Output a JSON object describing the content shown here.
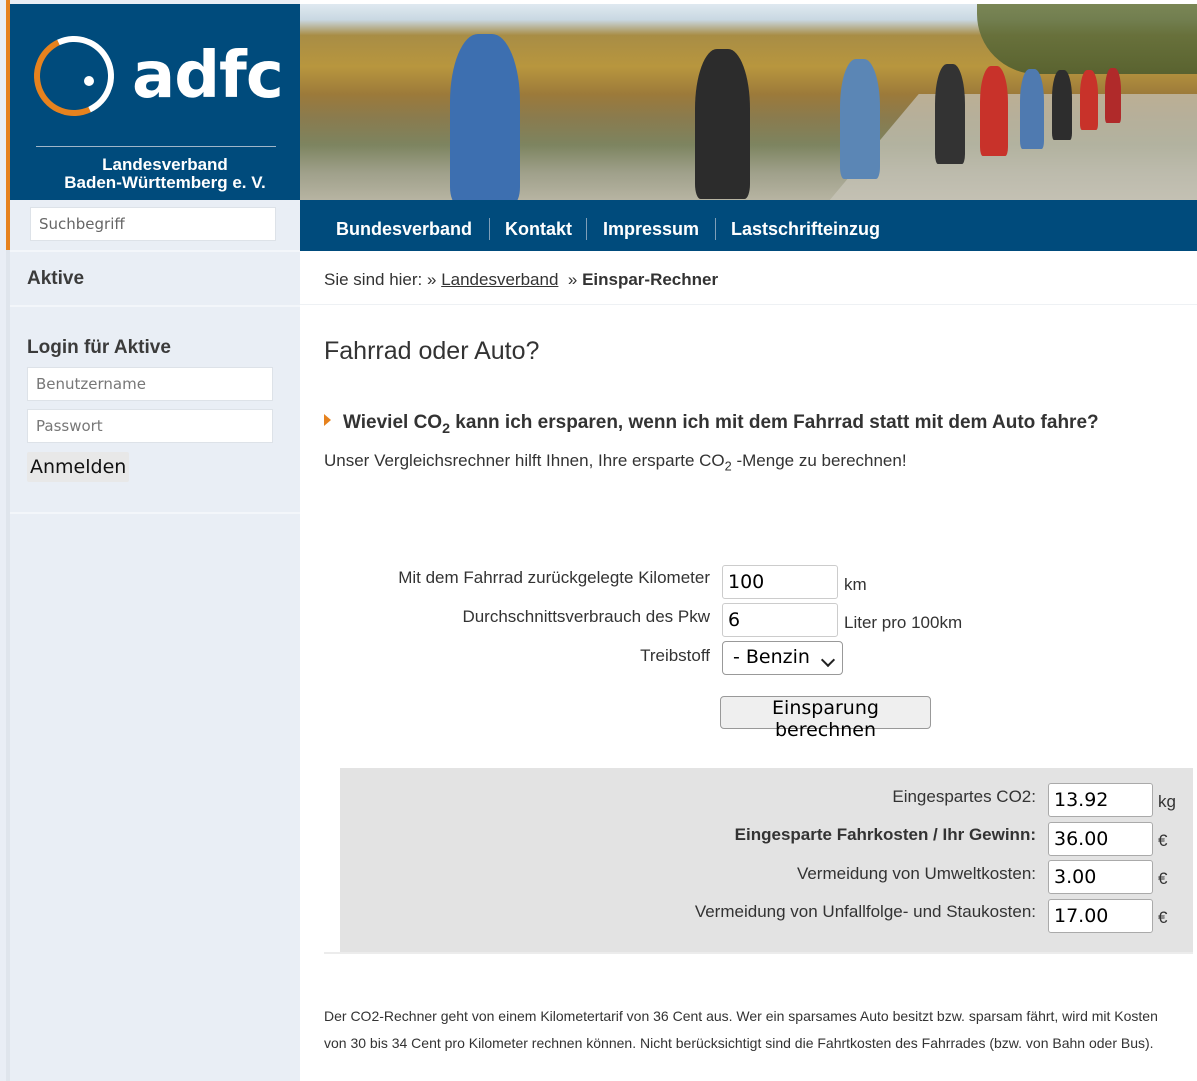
{
  "logo": {
    "name": "adfc",
    "subtitle_line1": "Landesverband",
    "subtitle_line2": "Baden-Württemberg e. V."
  },
  "sidebar": {
    "search_placeholder": "Suchbegriff",
    "aktive_label": "Aktive",
    "login_title": "Login für Aktive",
    "username_placeholder": "Benutzername",
    "password_placeholder": "Passwort",
    "login_button": "Anmelden"
  },
  "nav": {
    "items": [
      {
        "label": "Bundesverband"
      },
      {
        "label": "Kontakt"
      },
      {
        "label": "Impressum"
      },
      {
        "label": "Lastschrifteinzug"
      }
    ]
  },
  "breadcrumb": {
    "prefix": "Sie sind hier: »",
    "link": "Landesverband",
    "separator": "»",
    "current": "Einspar-Rechner"
  },
  "main": {
    "title": "Fahrrad oder Auto?",
    "question_part1": "Wieviel CO",
    "question_sub": "2",
    "question_part2": " kann ich ersparen, wenn ich mit dem Fahrrad statt mit dem Auto fahre?",
    "intro_part1": "Unser Vergleichsrechner hilft Ihnen, Ihre ersparte CO",
    "intro_sub": "2",
    "intro_part2": " -Menge zu berechnen!"
  },
  "form": {
    "km_label": "Mit dem Fahrrad zurückgelegte Kilometer",
    "km_value": "100",
    "km_unit": "km",
    "consumption_label": "Durchschnittsverbrauch des Pkw",
    "consumption_value": "6",
    "consumption_unit": "Liter pro 100km",
    "fuel_label": "Treibstoff",
    "fuel_selected": "- Benzin",
    "calc_button": "Einsparung berechnen"
  },
  "results": {
    "co2_label": "Eingespartes CO2:",
    "co2_value": "13.92",
    "co2_unit": "kg",
    "cost_label": "Eingesparte Fahrkosten / Ihr Gewinn:",
    "cost_value": "36.00",
    "cost_unit": "€",
    "env_label": "Vermeidung von Umweltkosten:",
    "env_value": "3.00",
    "env_unit": "€",
    "accident_label": "Vermeidung von Unfallfolge- und Staukosten:",
    "accident_value": "17.00",
    "accident_unit": "€"
  },
  "footer": {
    "note": "Der CO2-Rechner geht von einem Kilometertarif von 36 Cent aus. Wer ein sparsames Auto besitzt bzw. sparsam fährt, wird mit Kosten von 30 bis 34 Cent pro Kilometer rechnen können. Nicht berücksichtigt sind die Fahrtkosten des Fahrrades (bzw. von Bahn oder Bus)."
  },
  "colors": {
    "brand_blue": "#004b7c",
    "accent_orange": "#e6821e",
    "sidebar_bg": "#e9eef5",
    "results_bg": "#e3e3e3"
  }
}
